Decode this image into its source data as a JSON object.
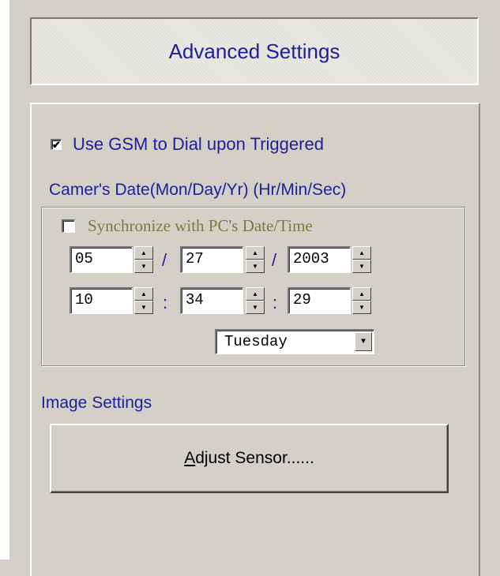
{
  "header": {
    "title": "Advanced Settings"
  },
  "gsm": {
    "label": "Use GSM to Dial upon Triggered",
    "checked": true
  },
  "date_section": {
    "heading": "Camer's Date(Mon/Day/Yr) (Hr/Min/Sec)",
    "sync_label": "Synchronize with PC's Date/Time",
    "sync_checked": false,
    "date_separator": "/",
    "time_separator": ":",
    "month": "05",
    "day": "27",
    "year": "2003",
    "hour": "10",
    "minute": "34",
    "second": "29",
    "weekday": "Tuesday"
  },
  "image_section": {
    "heading": "Image Settings",
    "adjust_button": {
      "mnemonic": "A",
      "rest": "djust Sensor......"
    }
  }
}
